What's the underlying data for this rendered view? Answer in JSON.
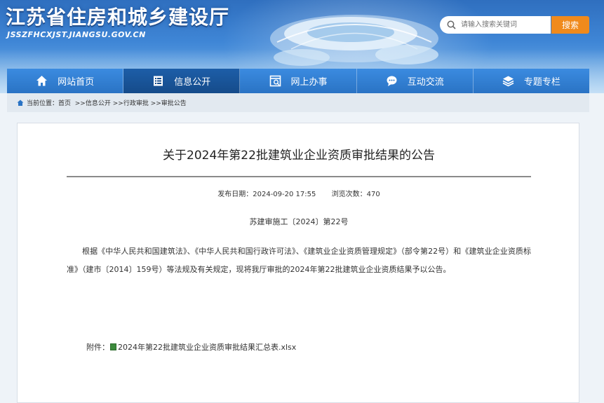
{
  "header": {
    "site_title": "江苏省住房和城乡建设厅",
    "site_domain": "JSSZFHCXJST.JIANGSU.GOV.CN",
    "search": {
      "placeholder": "请输入搜索关键词",
      "button_label": "搜索"
    }
  },
  "nav": {
    "items": [
      {
        "label": "网站首页",
        "icon": "home-icon"
      },
      {
        "label": "信息公开",
        "icon": "document-icon",
        "active": true
      },
      {
        "label": "网上办事",
        "icon": "window-icon"
      },
      {
        "label": "互动交流",
        "icon": "chat-icon"
      },
      {
        "label": "专题专栏",
        "icon": "layers-icon"
      }
    ]
  },
  "breadcrumb": {
    "prefix": "当前位置：",
    "items": [
      "首页",
      ">>信息公开",
      ">>行政审批",
      ">>审批公告"
    ]
  },
  "article": {
    "title": "关于2024年第22批建筑业企业资质审批结果的公告",
    "publish_label": "发布日期：",
    "publish_date": "2024-09-20 17:55",
    "views_label": "浏览次数：",
    "views": "470",
    "doc_number": "苏建审施工〔2024〕第22号",
    "body": "根据《中华人民共和国建筑法》、《中华人民共和国行政许可法》、《建筑业企业资质管理规定》（部令第22号）和《建筑业企业资质标准》（建市〔2014〕159号）等法规及有关规定，现将我厅审批的2024年第22批建筑业企业资质结果予以公告。",
    "attachment_label": "附件：",
    "attachment_name": "2024年第22批建筑业企业资质审批结果汇总表.xlsx"
  },
  "colors": {
    "nav_bg": "#2f7dcf",
    "nav_active": "#154b8a",
    "search_button": "#f08a1c"
  }
}
